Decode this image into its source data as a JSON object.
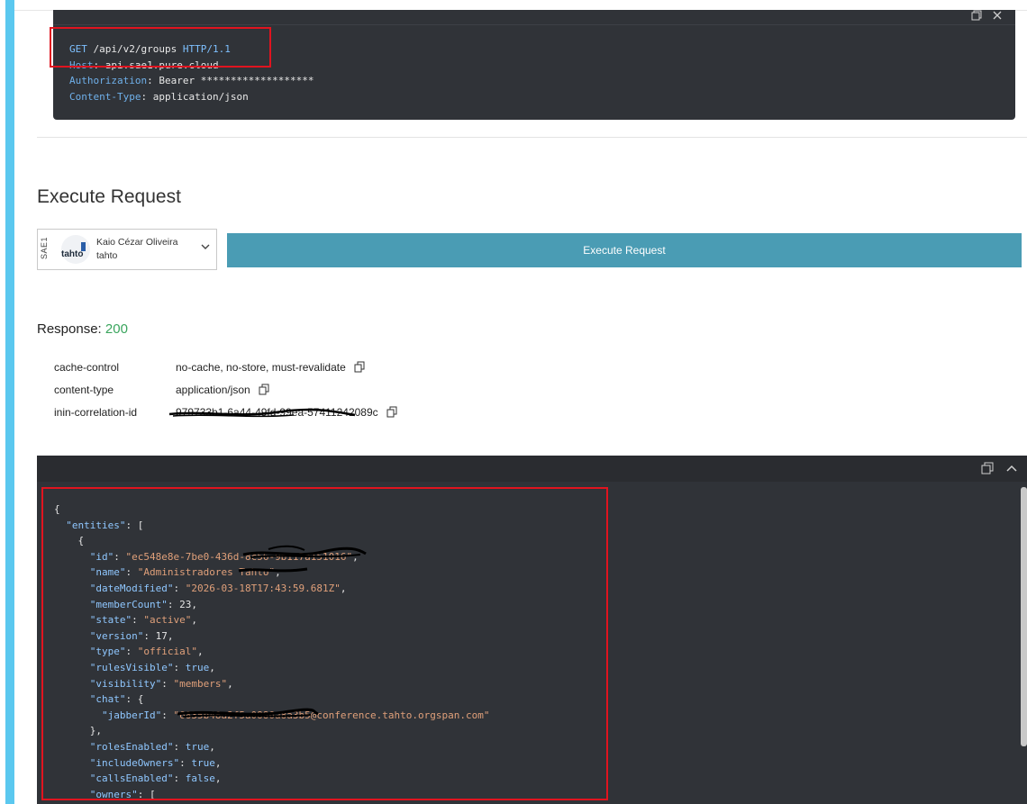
{
  "request": {
    "method": "GET",
    "path": "/api/v2/groups",
    "protocol": "HTTP/1.1",
    "headers": [
      {
        "key": "Host",
        "value": "api.sae1.pure.cloud"
      },
      {
        "key": "Authorization",
        "value": "Bearer *******************"
      },
      {
        "key": "Content-Type",
        "value": "application/json"
      }
    ]
  },
  "execute": {
    "heading": "Execute Request",
    "account": {
      "region": "SAE1",
      "logo_text": "tahto",
      "name": "Kaio Cézar Oliveira",
      "org": "tahto"
    },
    "button_label": "Execute Request"
  },
  "response": {
    "label": "Response:",
    "status": "200",
    "headers": [
      {
        "key": "cache-control",
        "value": "no-cache, no-store, must-revalidate"
      },
      {
        "key": "content-type",
        "value": "application/json"
      },
      {
        "key": "inin-correlation-id",
        "value": "979733b1-6a44-49fd-99ea-57411242089c"
      }
    ]
  },
  "json_lines": {
    "l1": "{",
    "l2_key": "\"entities\"",
    "l2_rest": ": [",
    "l3": "{",
    "id_key": "\"id\"",
    "id_val": "\"ec548e8e-7be0-436d-8c56-9b117a151016\"",
    "name_key": "\"name\"",
    "name_val": "\"Administradores Tahto\"",
    "date_key": "\"dateModified\"",
    "date_val": "\"2026-03-18T17:43:59.681Z\"",
    "member_key": "\"memberCount\"",
    "member_val": "23",
    "state_key": "\"state\"",
    "state_val": "\"active\"",
    "version_key": "\"version\"",
    "version_val": "17",
    "type_key": "\"type\"",
    "type_val": "\"official\"",
    "rules_key": "\"rulesVisible\"",
    "rules_val": "true",
    "vis_key": "\"visibility\"",
    "vis_val": "\"members\"",
    "chat_key": "\"chat\"",
    "chat_open": ": {",
    "jabber_key": "\"jabberId\"",
    "jabber_val": "\"6835b48a2f5a0886a8a3b5@conference.tahto.orgspan.com\"",
    "chat_close": "},",
    "roles_key": "\"rolesEnabled\"",
    "roles_val": "true",
    "owners_inc_key": "\"includeOwners\"",
    "owners_inc_val": "true",
    "calls_key": "\"callsEnabled\"",
    "calls_val": "false",
    "owners_key": "\"owners\"",
    "owners_open": ": ["
  }
}
